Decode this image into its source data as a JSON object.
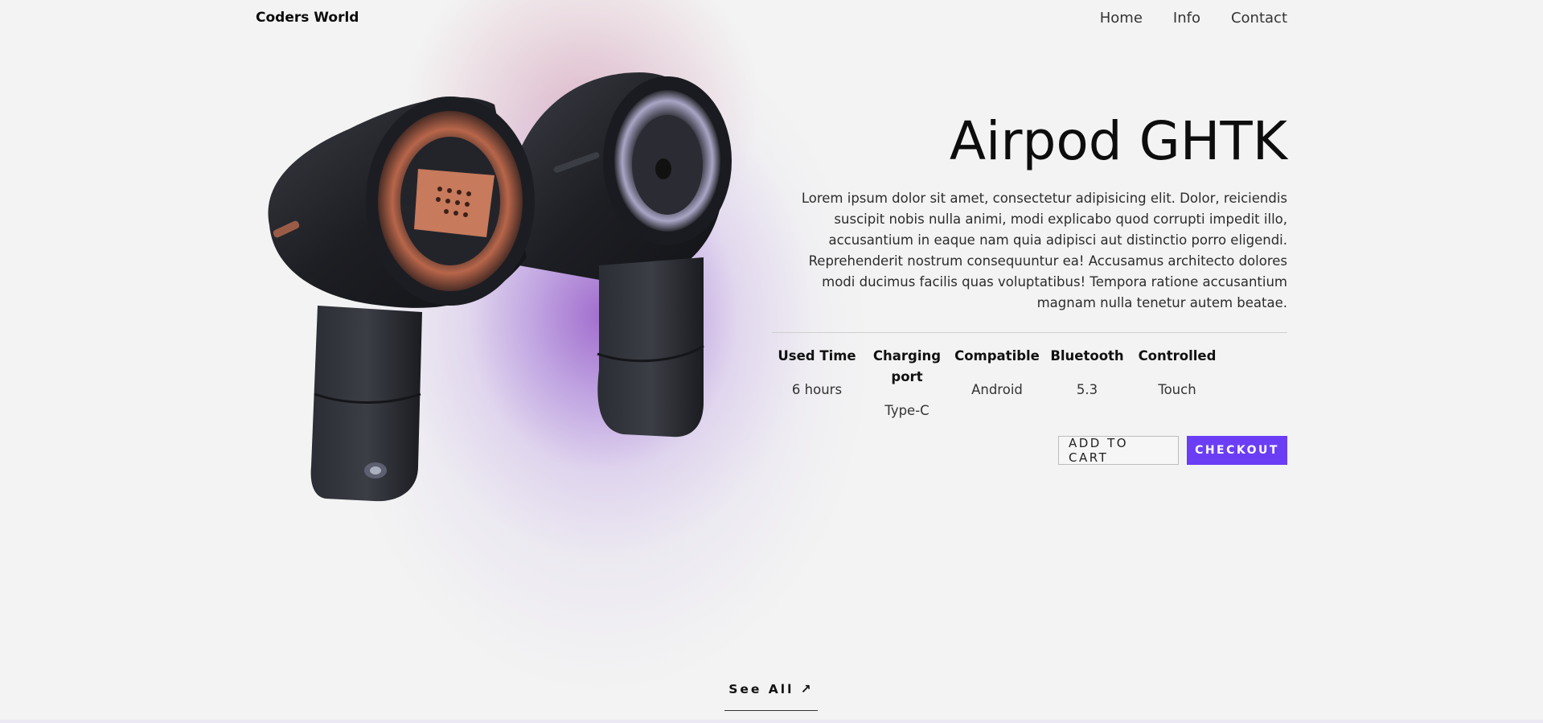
{
  "header": {
    "brand": "Coders World",
    "nav": [
      "Home",
      "Info",
      "Contact"
    ]
  },
  "product": {
    "title": "Airpod GHTK",
    "description": "Lorem ipsum dolor sit amet, consectetur adipisicing elit. Dolor, reiciendis suscipit nobis nulla animi, modi explicabo quod corrupti impedit illo, accusantium in eaque nam quia adipisci aut distinctio porro eligendi. Reprehenderit nostrum consequuntur ea! Accusamus architecto dolores modi ducimus facilis quas voluptatibus! Tempora ratione accusantium magnam nulla tenetur autem beatae.",
    "specs": [
      {
        "label": "Used Time",
        "value": "6 hours"
      },
      {
        "label": "Charging port",
        "value": "Type-C"
      },
      {
        "label": "Compatible",
        "value": "Android"
      },
      {
        "label": "Bluetooth",
        "value": "5.3"
      },
      {
        "label": "Controlled",
        "value": "Touch"
      }
    ],
    "add_to_cart_label": "ADD TO CART",
    "checkout_label": "CHECKOUT"
  },
  "footer": {
    "see_all_label": "See All ↗"
  },
  "colors": {
    "accent": "#6b3df5",
    "background": "#f3f3f3",
    "glow": "#9a6fd0"
  },
  "icons": [
    "arrow-up-right-icon"
  ]
}
